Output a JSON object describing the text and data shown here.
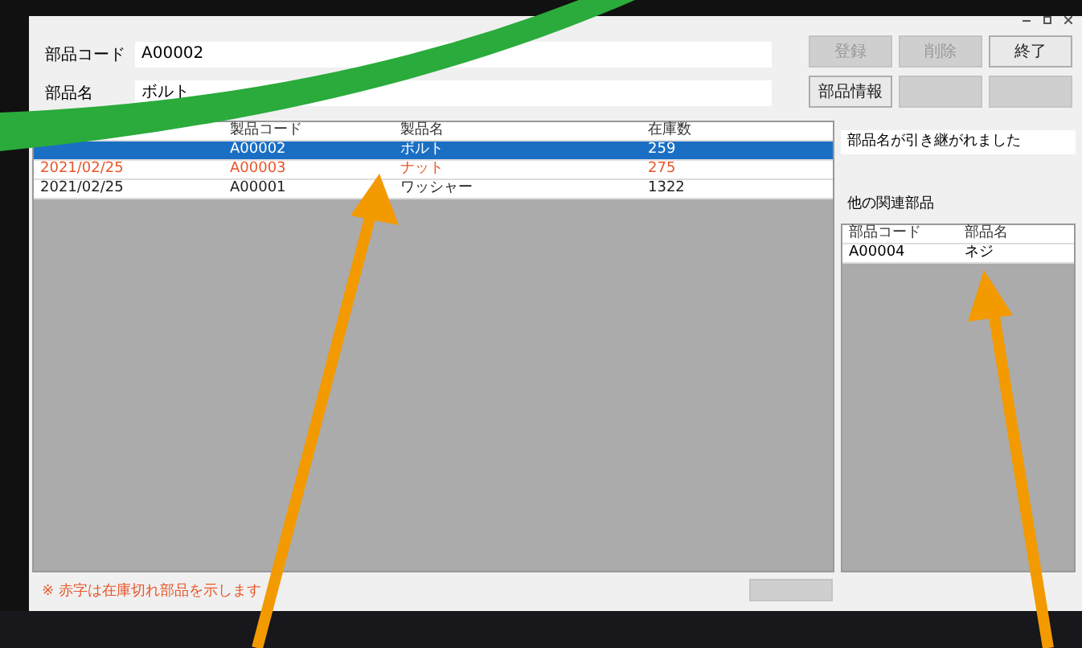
{
  "form": {
    "fields": [
      {
        "label": "部品コード",
        "value": "A00002"
      },
      {
        "label": "部品名",
        "value": "ボルト"
      }
    ],
    "buttons": [
      {
        "label": "登録",
        "disabled": true
      },
      {
        "label": "削除",
        "disabled": true
      },
      {
        "label": "終了",
        "disabled": false
      },
      {
        "label": "部品情報",
        "disabled": false
      },
      {
        "disabled": true
      },
      {
        "disabled": true
      }
    ]
  },
  "table": {
    "columns": [
      "製品コード",
      "製品名",
      "在庫数"
    ],
    "rows": [
      {
        "selected": true,
        "cells": [
          "A00002",
          "ボルト",
          "259"
        ]
      },
      {
        "selected": false,
        "date": "2021/02/25",
        "color": "#e8562a",
        "cells": [
          "A00003",
          "ナット",
          "275"
        ]
      },
      {
        "selected": false,
        "date": "2021/02/25",
        "color": "#222222",
        "cells": [
          "A00001",
          "ワッシャー",
          "1322"
        ]
      }
    ]
  },
  "message": "部品名が引き継がれました",
  "related": {
    "label": "他の関連部品",
    "columns": [
      "部品コード",
      "部品名"
    ],
    "rows": [
      [
        "A00004",
        "ネジ"
      ]
    ]
  },
  "note": "※ 赤字は在庫切れ部品を示します"
}
